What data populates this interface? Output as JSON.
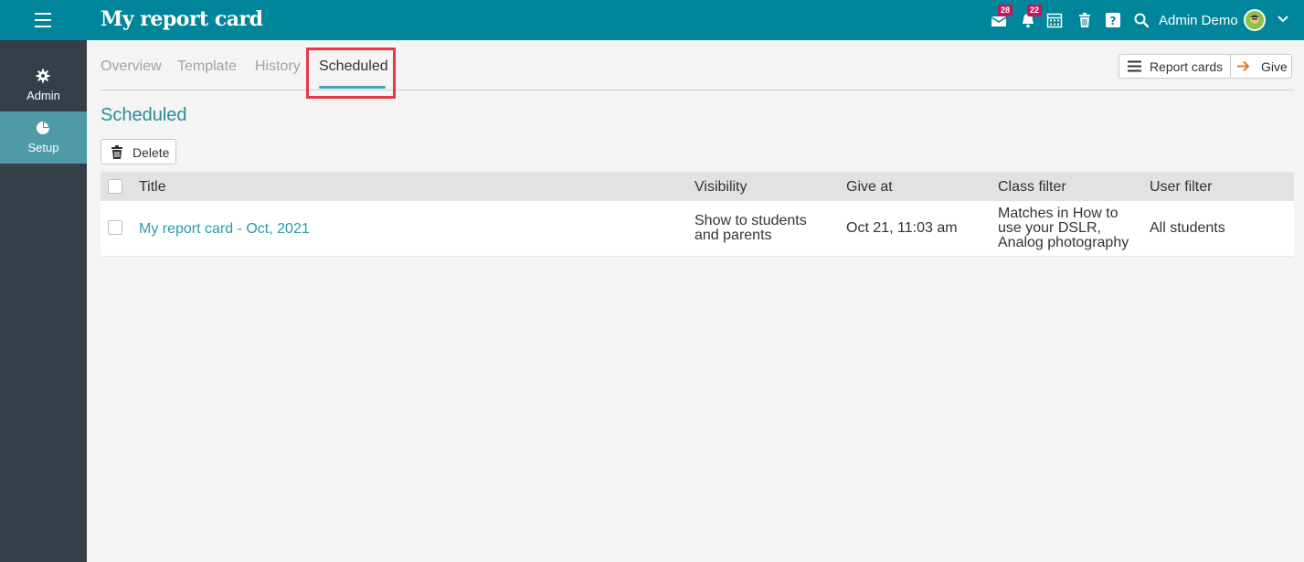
{
  "header": {
    "title": "My report card",
    "messages_badge": "28",
    "notifications_badge": "22",
    "user_name": "Admin Demo"
  },
  "sidebar": {
    "items": [
      {
        "label": "Admin",
        "icon": "gear-icon"
      },
      {
        "label": "Setup",
        "icon": "pie-chart-icon",
        "active": true
      }
    ]
  },
  "tabs": [
    {
      "label": "Overview"
    },
    {
      "label": "Template"
    },
    {
      "label": "History"
    },
    {
      "label": "Scheduled",
      "active": true
    }
  ],
  "actions": {
    "report_cards_label": "Report cards",
    "give_label": "Give"
  },
  "section": {
    "title": "Scheduled",
    "delete_label": "Delete"
  },
  "table": {
    "columns": [
      "Title",
      "Visibility",
      "Give at",
      "Class filter",
      "User filter"
    ],
    "rows": [
      {
        "title": "My report card - Oct, 2021",
        "visibility_line1": "Show to students",
        "visibility_line2": "and parents",
        "give_at": "Oct 21, 11:03 am",
        "class_filter_line1": "Matches in How to",
        "class_filter_line2": "use your DSLR,",
        "class_filter_line3": "Analog photography",
        "user_filter": "All students"
      }
    ]
  },
  "colors": {
    "topbar": "#00859a",
    "sidebar": "#363e4a",
    "sidebar_active": "#4f9aa7",
    "accent": "#2b8b9a",
    "badge": "#c2185b",
    "highlight": "#e53945"
  }
}
